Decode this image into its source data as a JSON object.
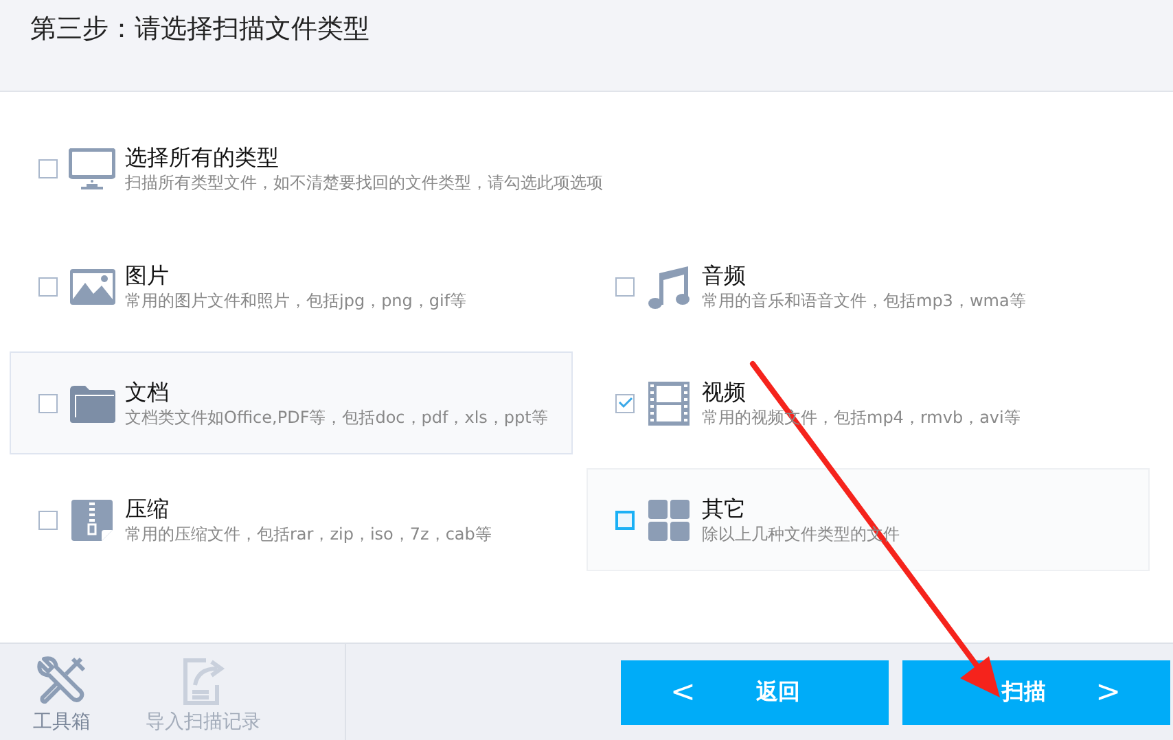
{
  "header": {
    "title": "第三步：请选择扫描文件类型"
  },
  "all_types": {
    "title": "选择所有的类型",
    "description": "扫描所有类型文件，如不清楚要找回的文件类型，请勾选此项选项",
    "checked": false
  },
  "types": [
    {
      "title": "图片",
      "description": "常用的图片文件和照片，包括jpg，png，gif等",
      "checked": false,
      "focused": false,
      "hovered": false
    },
    {
      "title": "音频",
      "description": "常用的音乐和语音文件，包括mp3，wma等",
      "checked": false,
      "focused": false,
      "hovered": false
    },
    {
      "title": "文档",
      "description": "文档类文件如Office,PDF等，包括doc，pdf，xls，ppt等",
      "checked": false,
      "focused": false,
      "hovered": true
    },
    {
      "title": "视频",
      "description": "常用的视频文件，包括mp4，rmvb，avi等",
      "checked": true,
      "focused": false,
      "hovered": false
    },
    {
      "title": "压缩",
      "description": "常用的压缩文件，包括rar，zip，iso，7z，cab等",
      "checked": false,
      "focused": false,
      "hovered": false
    },
    {
      "title": "其它",
      "description": "除以上几种文件类型的文件",
      "checked": false,
      "focused": true,
      "hovered": false
    }
  ],
  "footer": {
    "tools": [
      {
        "label": "工具箱",
        "disabled": false
      },
      {
        "label": "导入扫描记录",
        "disabled": true
      }
    ],
    "back_button": {
      "arrow": "<",
      "label": "返回"
    },
    "scan_button": {
      "label": "扫描",
      "arrow": ">"
    }
  },
  "annotation": {
    "kind": "arrow"
  }
}
